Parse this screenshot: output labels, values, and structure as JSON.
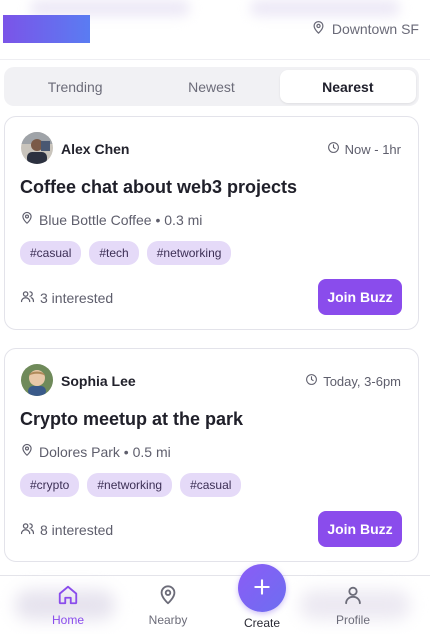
{
  "header": {
    "location": "Downtown SF",
    "location_icon": "map-pin-icon",
    "brand_gradient": [
      "#7b54e8",
      "#5a7cf2"
    ]
  },
  "tabs": [
    {
      "label": "Trending",
      "active": false
    },
    {
      "label": "Newest",
      "active": false
    },
    {
      "label": "Nearest",
      "active": true
    }
  ],
  "posts": [
    {
      "author": "Alex Chen",
      "time": "Now - 1hr",
      "title": "Coffee chat about web3 projects",
      "place": "Blue Bottle Coffee • 0.3 mi",
      "tags": [
        "#casual",
        "#tech",
        "#networking"
      ],
      "interested": "3 interested",
      "join_label": "Join Buzz"
    },
    {
      "author": "Sophia Lee",
      "time": "Today, 3-6pm",
      "title": "Crypto meetup at the park",
      "place": "Dolores Park • 0.5 mi",
      "tags": [
        "#crypto",
        "#networking",
        "#casual"
      ],
      "interested": "8 interested",
      "join_label": "Join Buzz"
    }
  ],
  "bottom_nav": {
    "home": "Home",
    "nearby": "Nearby",
    "create": "Create",
    "profile": "Profile"
  },
  "colors": {
    "accent": "#8a4cec",
    "tag_bg": "#e5daf8"
  }
}
